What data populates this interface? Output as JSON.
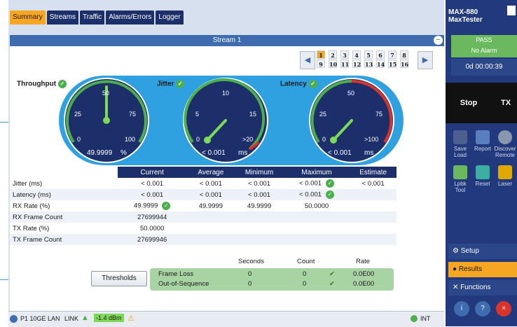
{
  "tabs": [
    "Summary",
    "Streams",
    "Traffic",
    "Alarms/Errors",
    "Logger"
  ],
  "active_tab": "Summary",
  "stream_title": "Stream 1",
  "pager": {
    "row1": [
      "1",
      "2",
      "3",
      "4",
      "5",
      "6",
      "7",
      "8"
    ],
    "row2": [
      "9",
      "10",
      "11",
      "12",
      "13",
      "14",
      "15",
      "16"
    ],
    "active": "1"
  },
  "gauges": {
    "throughput": {
      "label": "Throughput",
      "min": "0",
      "mid_low": "25",
      "mid": "50",
      "mid_high": "75",
      "max": "100",
      "value": "49.9999",
      "unit": "%"
    },
    "jitter": {
      "label": "Jitter",
      "min": "0",
      "mid_low": "5",
      "mid": "10",
      "mid_high": "15",
      "max": ">20",
      "value": "< 0.001",
      "unit": "ms"
    },
    "latency": {
      "label": "Latency",
      "min": "0",
      "mid_low": "25",
      "mid": "50",
      "mid_high": "75",
      "max": ">100",
      "value": "< 0.001",
      "unit": "ms"
    }
  },
  "table": {
    "headers": [
      "Current",
      "Average",
      "Minimum",
      "Maximum",
      "Estimate"
    ],
    "rows": [
      {
        "label": "Jitter (ms)",
        "current": "< 0.001",
        "average": "< 0.001",
        "minimum": "< 0.001",
        "maximum": "< 0.001",
        "estimate": "< 0.001"
      },
      {
        "label": "Latency (ms)",
        "current": "< 0.001",
        "average": "< 0.001",
        "minimum": "< 0.001",
        "maximum": "< 0.001",
        "estimate": ""
      },
      {
        "label": "RX Rate (%)",
        "current": "49.9999",
        "average": "49.9999",
        "minimum": "49.9999",
        "maximum": "50.0000",
        "estimate": ""
      },
      {
        "label": "RX Frame Count",
        "current": "27699944",
        "average": "",
        "minimum": "",
        "maximum": "",
        "estimate": ""
      },
      {
        "label": "TX Rate (%)",
        "current": "50.0000",
        "average": "",
        "minimum": "",
        "maximum": "",
        "estimate": ""
      },
      {
        "label": "TX Frame Count",
        "current": "27699946",
        "average": "",
        "minimum": "",
        "maximum": "",
        "estimate": ""
      }
    ]
  },
  "thresholds_label": "Thresholds",
  "loss": {
    "headers": [
      "Seconds",
      "Count",
      "Rate"
    ],
    "rows": [
      {
        "label": "Frame Loss",
        "seconds": "0",
        "count": "0",
        "rate": "0.0E00"
      },
      {
        "label": "Out-of-Sequence",
        "seconds": "0",
        "count": "0",
        "rate": "0.0E00"
      }
    ]
  },
  "status": {
    "port": "P1 10GE LAN",
    "link": "LINK",
    "power": "-1.4 dBm",
    "clock": "INT"
  },
  "side": {
    "device_line1": "MAX-880",
    "device_line2": "MaxTester",
    "pass_label": "PASS",
    "alarm_label": "No Alarm",
    "timer": "0d 00:00:39",
    "stop_label": "Stop",
    "tx_label": "TX",
    "buttons": [
      "Save Load",
      "Report",
      "Discover Remote",
      "Lpbk Tool",
      "Reset",
      "Laser"
    ],
    "menu": [
      "Setup",
      "Results",
      "Functions"
    ]
  },
  "colors": {
    "accent": "#f5a623",
    "navy": "#1c2f6b",
    "pass_green": "#6ab95f",
    "gauge_blue": "#2fa0e0"
  }
}
